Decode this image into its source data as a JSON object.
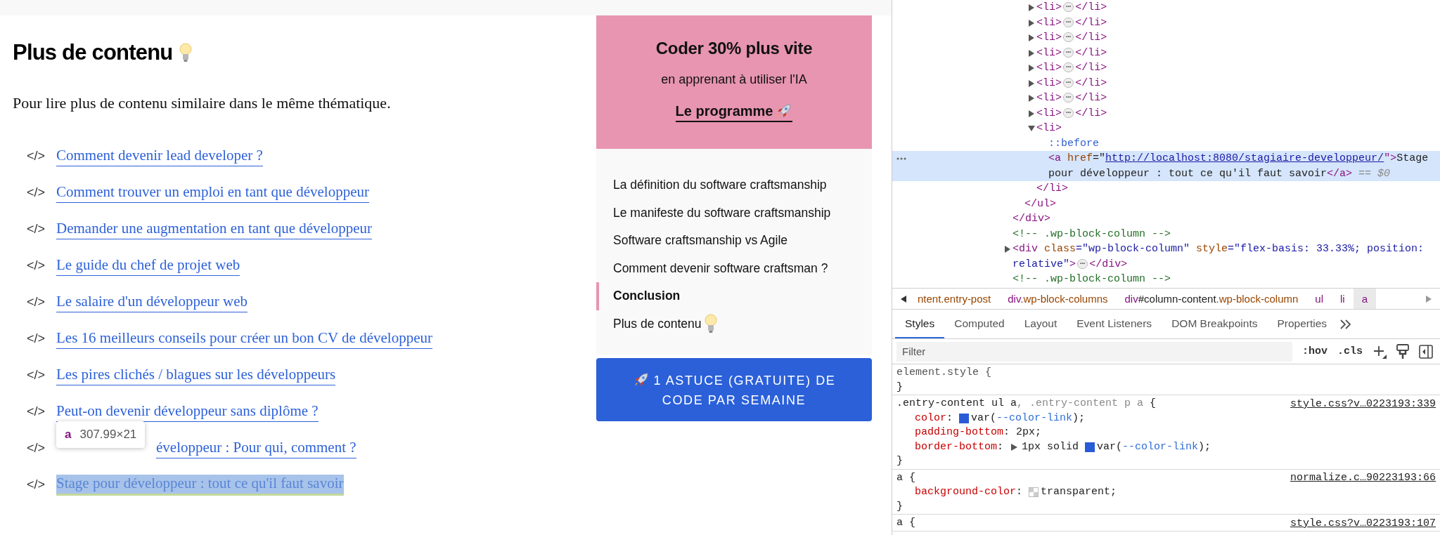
{
  "article": {
    "heading": "Plus de contenu",
    "intro": "Pour lire plus de contenu similaire dans le même thématique.",
    "links": [
      {
        "marker": "</>",
        "text": "Comment devenir lead developer ?",
        "kind": "plain",
        "highlighted": false
      },
      {
        "marker": "</>",
        "text": "Comment trouver un emploi en tant que développeur",
        "kind": "plain",
        "highlighted": false
      },
      {
        "marker": "</>",
        "text": "Demander une augmentation en tant que développeur",
        "kind": "plain",
        "highlighted": false
      },
      {
        "marker": "</>",
        "text": "Le guide du chef de projet web",
        "kind": "plain",
        "highlighted": false
      },
      {
        "marker": "</>",
        "text": "Le salaire d'un développeur web",
        "kind": "plain",
        "highlighted": false
      },
      {
        "marker": "</>",
        "text": "Les 16 meilleurs conseils pour créer un bon CV de développeur",
        "kind": "plain",
        "highlighted": false
      },
      {
        "marker": "</>",
        "text": "Les pires clichés / blagues sur les développeurs",
        "kind": "plain",
        "highlighted": false
      },
      {
        "marker": "</>",
        "text": "Peut-on devenir développeur sans diplôme ?",
        "kind": "plain",
        "highlighted": false
      },
      {
        "marker": "</>",
        "text": "éveloppeur : Pour qui, comment ?",
        "kind": "covered",
        "highlighted": false
      },
      {
        "marker": "</>",
        "text": "Stage pour développeur : tout ce qu'il faut savoir",
        "kind": "plain",
        "highlighted": true
      }
    ],
    "inspect_tooltip": {
      "tag": "a",
      "size": "307.99×21"
    }
  },
  "sidebar": {
    "promo": {
      "title": "Coder 30% plus vite",
      "subtitle": "en apprenant à utiliser l'IA",
      "link": "Le programme"
    },
    "toc": [
      {
        "text": "La définition du software craftsmanship",
        "selected": false,
        "trailing_icon": false
      },
      {
        "text": "Le manifeste du software craftsmanship",
        "selected": false,
        "trailing_icon": false
      },
      {
        "text": "Software craftsmanship vs Agile",
        "selected": false,
        "trailing_icon": false
      },
      {
        "text": "Comment devenir software craftsman ?",
        "selected": false,
        "trailing_icon": false
      },
      {
        "text": "Conclusion",
        "selected": true,
        "trailing_icon": false
      },
      {
        "text": "Plus de contenu",
        "selected": false,
        "trailing_icon": true
      }
    ],
    "cta": "1 ASTUCE (GRATUITE) DE CODE PAR SEMAINE"
  },
  "devtools": {
    "dom_tree": [
      {
        "kind": "fragment",
        "selected": false,
        "close": [
          {
            "text": "</div>",
            "kind": "tag"
          }
        ],
        "children": [
          {
            "kind": "fragment",
            "selected": false,
            "close": [
              {
                "text": "</ul>",
                "kind": "tag"
              }
            ],
            "children": [
              {
                "kind": "element",
                "expanded": false,
                "selected": false,
                "open": [
                  {
                    "text": "<li>",
                    "kind": "tag"
                  }
                ],
                "collapsed_marker": "⋯",
                "close": [
                  {
                    "text": "</li>",
                    "kind": "tag"
                  }
                ]
              },
              {
                "kind": "element",
                "expanded": false,
                "selected": false,
                "open": [
                  {
                    "text": "<li>",
                    "kind": "tag"
                  }
                ],
                "collapsed_marker": "⋯",
                "close": [
                  {
                    "text": "</li>",
                    "kind": "tag"
                  }
                ]
              },
              {
                "kind": "element",
                "expanded": false,
                "selected": false,
                "open": [
                  {
                    "text": "<li>",
                    "kind": "tag"
                  }
                ],
                "collapsed_marker": "⋯",
                "close": [
                  {
                    "text": "</li>",
                    "kind": "tag"
                  }
                ]
              },
              {
                "kind": "element",
                "expanded": false,
                "selected": false,
                "open": [
                  {
                    "text": "<li>",
                    "kind": "tag"
                  }
                ],
                "collapsed_marker": "⋯",
                "close": [
                  {
                    "text": "</li>",
                    "kind": "tag"
                  }
                ]
              },
              {
                "kind": "element",
                "expanded": false,
                "selected": false,
                "open": [
                  {
                    "text": "<li>",
                    "kind": "tag"
                  }
                ],
                "collapsed_marker": "⋯",
                "close": [
                  {
                    "text": "</li>",
                    "kind": "tag"
                  }
                ]
              },
              {
                "kind": "element",
                "expanded": false,
                "selected": false,
                "open": [
                  {
                    "text": "<li>",
                    "kind": "tag"
                  }
                ],
                "collapsed_marker": "⋯",
                "close": [
                  {
                    "text": "</li>",
                    "kind": "tag"
                  }
                ]
              },
              {
                "kind": "element",
                "expanded": false,
                "selected": false,
                "open": [
                  {
                    "text": "<li>",
                    "kind": "tag"
                  }
                ],
                "collapsed_marker": "⋯",
                "close": [
                  {
                    "text": "</li>",
                    "kind": "tag"
                  }
                ]
              },
              {
                "kind": "element",
                "expanded": false,
                "selected": false,
                "open": [
                  {
                    "text": "<li>",
                    "kind": "tag"
                  }
                ],
                "collapsed_marker": "⋯",
                "close": [
                  {
                    "text": "</li>",
                    "kind": "tag"
                  }
                ]
              },
              {
                "kind": "element",
                "expanded": true,
                "selected": false,
                "open": [
                  {
                    "text": "<li>",
                    "kind": "tag"
                  }
                ],
                "close": [
                  {
                    "text": "</li>",
                    "kind": "tag"
                  }
                ],
                "children": [
                  {
                    "kind": "leaf",
                    "selected": false,
                    "open": [
                      {
                        "text": "::before",
                        "kind": "pseudo"
                      }
                    ]
                  },
                  {
                    "kind": "leaf",
                    "selected": true,
                    "open": [
                      {
                        "text": "<a ",
                        "kind": "tag"
                      },
                      {
                        "text": "href",
                        "kind": "attr"
                      },
                      {
                        "text": "=\"",
                        "kind": "plain"
                      },
                      {
                        "text": "http://localhost:8080/stagiaire-developpeur/",
                        "kind": "link"
                      },
                      {
                        "text": "\">",
                        "kind": "tag"
                      },
                      {
                        "text": "Stage pour développeur : tout ce qu'il faut savoir",
                        "kind": "plain"
                      },
                      {
                        "text": "</a>",
                        "kind": "tag"
                      },
                      {
                        "text": " == $0",
                        "kind": "dim"
                      }
                    ]
                  }
                ]
              }
            ]
          }
        ]
      },
      {
        "kind": "leaf",
        "selected": false,
        "open": [
          {
            "text": "<!-- .wp-block-column -->",
            "kind": "comment"
          }
        ]
      },
      {
        "kind": "element",
        "expanded": false,
        "selected": false,
        "open": [
          {
            "text": "<div ",
            "kind": "tag"
          },
          {
            "text": "class",
            "kind": "attr"
          },
          {
            "text": "=\"wp-block-column\" ",
            "kind": "value"
          },
          {
            "text": "style",
            "kind": "attr"
          },
          {
            "text": "=\"flex-basis: 33.33%; position: relative\"",
            "kind": "value"
          },
          {
            "text": ">",
            "kind": "tag"
          }
        ],
        "collapsed_marker": "⋯",
        "close": [
          {
            "text": "</div>",
            "kind": "tag"
          }
        ]
      },
      {
        "kind": "leaf",
        "selected": false,
        "open": [
          {
            "text": "<!-- .wp-block-column -->",
            "kind": "comment"
          }
        ]
      }
    ],
    "breadcrumbs": [
      {
        "selected": false,
        "tokens": [
          {
            "text": "ntent.entry-post",
            "kind": "attr"
          }
        ]
      },
      {
        "selected": false,
        "tokens": [
          {
            "text": "div",
            "kind": "tag"
          },
          {
            "text": ".wp-block-columns",
            "kind": "attr"
          }
        ]
      },
      {
        "selected": false,
        "tokens": [
          {
            "text": "div",
            "kind": "tag"
          },
          {
            "text": "#column-content",
            "kind": "plain"
          },
          {
            "text": ".wp-block-column",
            "kind": "attr"
          }
        ]
      },
      {
        "selected": false,
        "tokens": [
          {
            "text": "ul",
            "kind": "tag"
          }
        ]
      },
      {
        "selected": false,
        "tokens": [
          {
            "text": "li",
            "kind": "tag"
          }
        ]
      },
      {
        "selected": true,
        "tokens": [
          {
            "text": "a",
            "kind": "tag"
          }
        ]
      }
    ],
    "tabs": [
      {
        "label": "Styles",
        "selected": true
      },
      {
        "label": "Computed",
        "selected": false
      },
      {
        "label": "Layout",
        "selected": false
      },
      {
        "label": "Event Listeners",
        "selected": false
      },
      {
        "label": "DOM Breakpoints",
        "selected": false
      },
      {
        "label": "Properties",
        "selected": false
      }
    ],
    "filter": {
      "placeholder": "Filter",
      "buttons": [
        ":hov",
        ".cls"
      ]
    },
    "rules": [
      {
        "lines": [
          {
            "kind": "selector",
            "tokens": [
              {
                "text": "element.style {",
                "kind": "sel"
              }
            ]
          },
          {
            "kind": "close",
            "tokens": [
              {
                "text": "}",
                "kind": "plain"
              }
            ]
          }
        ]
      },
      {
        "source": "style.css?v…0223193:339",
        "lines": [
          {
            "kind": "selector",
            "tokens": [
              {
                "text": ".entry-content ul a",
                "kind": "plain"
              },
              {
                "text": ", .entry-content p a",
                "kind": "dim"
              },
              {
                "text": " {",
                "kind": "plain"
              }
            ]
          },
          {
            "kind": "declaration",
            "tokens": [
              {
                "text": "color",
                "kind": "prop"
              },
              {
                "text": ": ",
                "kind": "plain"
              },
              {
                "kind": "swatch",
                "color": "#2a5bd7"
              },
              {
                "text": "var(",
                "kind": "plain"
              },
              {
                "text": "--color-link",
                "kind": "var"
              },
              {
                "text": ");",
                "kind": "plain"
              }
            ]
          },
          {
            "kind": "declaration",
            "tokens": [
              {
                "text": "padding-bottom",
                "kind": "prop"
              },
              {
                "text": ": 2px;",
                "kind": "plain"
              }
            ]
          },
          {
            "kind": "declaration",
            "tokens": [
              {
                "text": "border-bottom",
                "kind": "prop"
              },
              {
                "text": ": ",
                "kind": "plain"
              },
              {
                "kind": "toggle"
              },
              {
                "text": "1px solid ",
                "kind": "plain"
              },
              {
                "kind": "swatch",
                "color": "#2a5bd7"
              },
              {
                "text": "var(",
                "kind": "plain"
              },
              {
                "text": "--color-link",
                "kind": "var"
              },
              {
                "text": ");",
                "kind": "plain"
              }
            ]
          },
          {
            "kind": "close",
            "tokens": [
              {
                "text": "}",
                "kind": "plain"
              }
            ]
          }
        ]
      },
      {
        "source": "normalize.c…90223193:66",
        "lines": [
          {
            "kind": "selector",
            "tokens": [
              {
                "text": "a {",
                "kind": "plain"
              }
            ]
          },
          {
            "kind": "declaration",
            "tokens": [
              {
                "text": "background-color",
                "kind": "prop"
              },
              {
                "text": ": ",
                "kind": "plain"
              },
              {
                "kind": "checker"
              },
              {
                "text": "transparent;",
                "kind": "plain"
              }
            ]
          },
          {
            "kind": "close",
            "tokens": [
              {
                "text": "}",
                "kind": "plain"
              }
            ]
          }
        ]
      },
      {
        "source": "style.css?v…0223193:107",
        "lines": [
          {
            "kind": "selector",
            "tokens": [
              {
                "text": "a {",
                "kind": "plain"
              }
            ]
          }
        ]
      }
    ]
  }
}
